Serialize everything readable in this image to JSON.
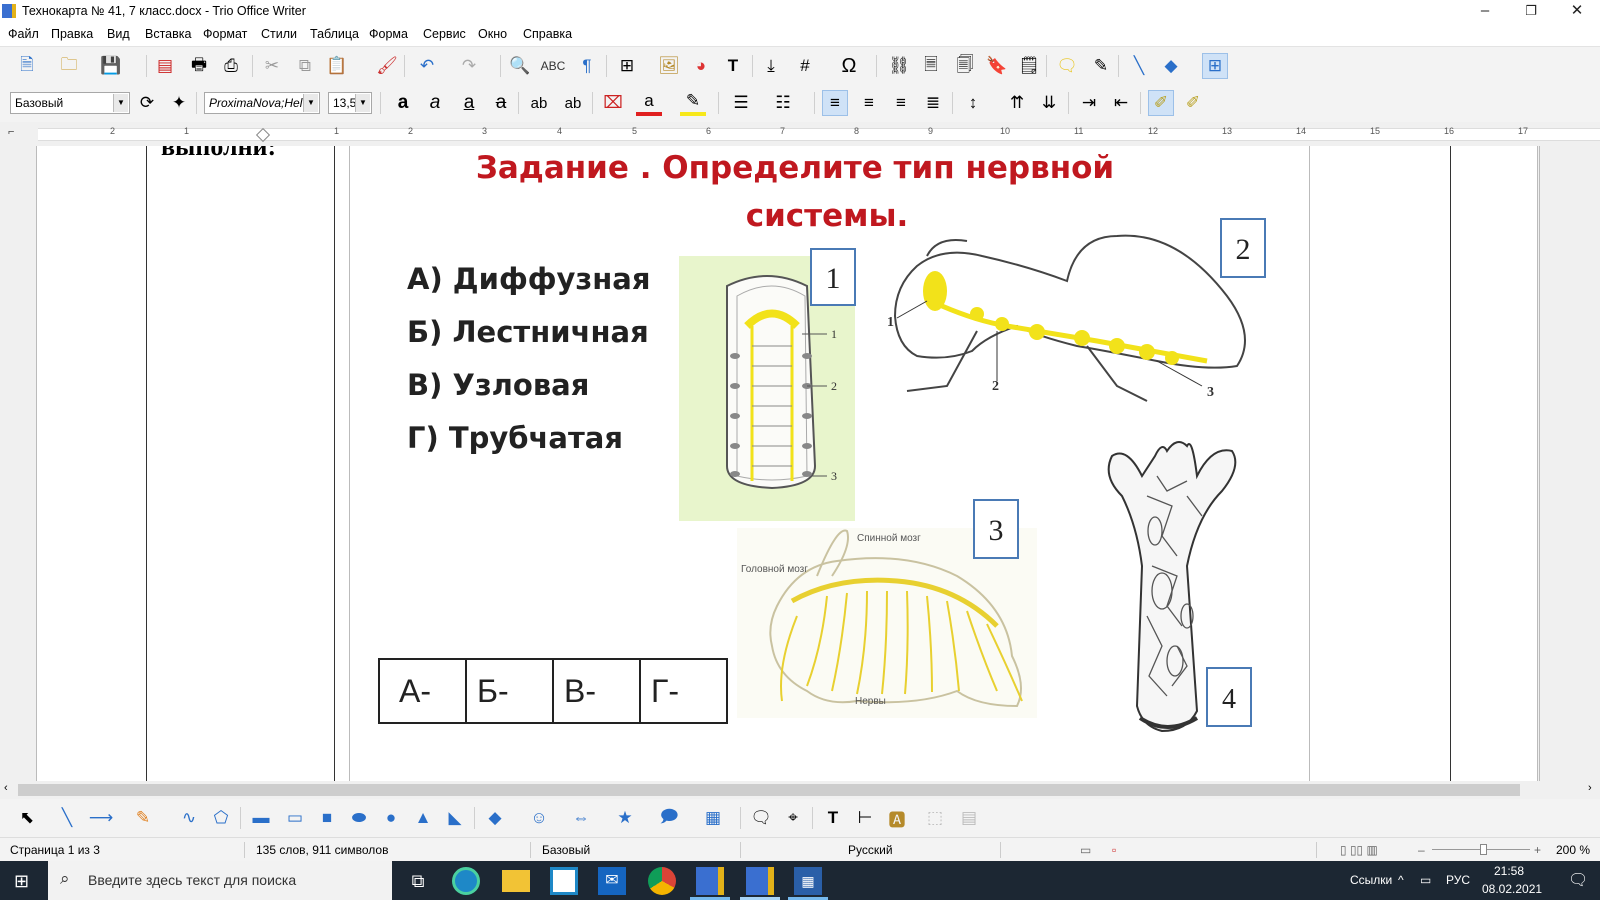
{
  "window": {
    "title": "Технокарта № 41, 7 класс.docx - Trio Office Writer",
    "controls": {
      "minimize": "–",
      "restore": "❐",
      "close": "✕"
    }
  },
  "menu": [
    "Файл",
    "Правка",
    "Вид",
    "Вставка",
    "Формат",
    "Стили",
    "Таблица",
    "Форма",
    "Сервис",
    "Окно",
    "Справка"
  ],
  "format_toolbar": {
    "paragraph_style": "Базовый",
    "font_name": "ProximaNova;Helv",
    "font_size": "13,5"
  },
  "ruler": {
    "numbers": [
      "2",
      "1",
      "1",
      "2",
      "3",
      "4",
      "5",
      "6",
      "7",
      "8",
      "9",
      "10",
      "11",
      "12",
      "13",
      "14",
      "15",
      "16",
      "17"
    ]
  },
  "document": {
    "left_cell_text": "выполни:",
    "task_title_line1": "Задание  . Определите  тип нервной",
    "task_title_line2": "системы.",
    "options": [
      "А)  Диффузная",
      "Б)  Лестничная",
      "В)  Узловая",
      "Г)  Трубчатая"
    ],
    "answer_table": [
      "А-",
      "Б-",
      "В-",
      "Г-"
    ],
    "figures": {
      "fig1": {
        "number": "1",
        "labels": [
          "1",
          "2",
          "3"
        ]
      },
      "fig2": {
        "number": "2",
        "labels": [
          "1",
          "2",
          "3"
        ]
      },
      "fig3": {
        "number": "3",
        "labels": [
          "Спинной мозг",
          "Головной мозг",
          "Нервы"
        ]
      },
      "fig4": {
        "number": "4"
      }
    },
    "colors": {
      "title": "#c0181f",
      "nerve": "#f2e21a",
      "figure_bg": "#e8f5cc"
    }
  },
  "status": {
    "page": "Страница 1 из 3",
    "words": "135 слов, 911 символов",
    "style": "Базовый",
    "language": "Русский",
    "zoom": "200 %"
  },
  "taskbar": {
    "search_placeholder": "Введите здесь текст для поиска",
    "links": "Ссылки",
    "lang": "РУС",
    "time": "21:58",
    "date": "08.02.2021"
  }
}
